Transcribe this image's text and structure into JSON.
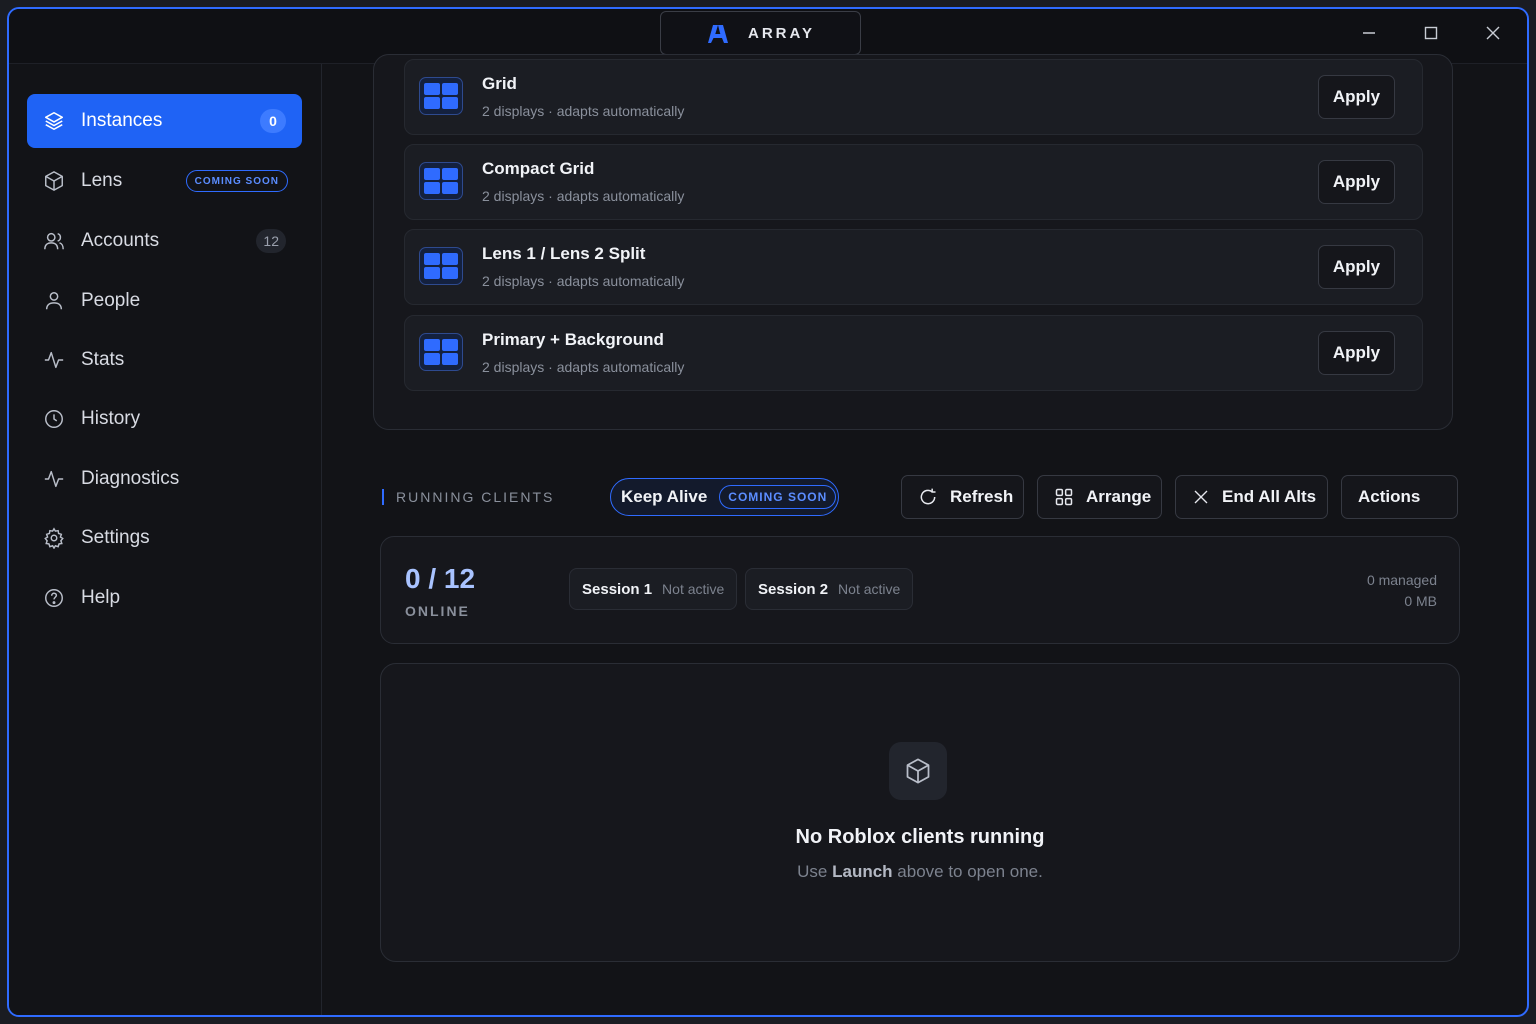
{
  "app": {
    "title": "ARRAY"
  },
  "sidebar": {
    "items": [
      {
        "label": "Instances",
        "badge": "0",
        "icon": "layers-icon",
        "active": true
      },
      {
        "label": "Lens",
        "soon": "COMING SOON",
        "icon": "cube-icon"
      },
      {
        "label": "Accounts",
        "badge": "12",
        "icon": "users-icon"
      },
      {
        "label": "People",
        "icon": "person-icon"
      },
      {
        "label": "Stats",
        "icon": "activity-icon"
      },
      {
        "label": "History",
        "icon": "clock-icon"
      },
      {
        "label": "Diagnostics",
        "icon": "pulse-icon"
      },
      {
        "label": "Settings",
        "icon": "gear-icon"
      },
      {
        "label": "Help",
        "icon": "help-icon"
      }
    ]
  },
  "layouts": [
    {
      "title": "Grid",
      "subtitle": "2 displays · adapts automatically",
      "apply": "Apply"
    },
    {
      "title": "Compact Grid",
      "subtitle": "2 displays · adapts automatically",
      "apply": "Apply"
    },
    {
      "title": "Lens 1 / Lens 2 Split",
      "subtitle": "2 displays · adapts automatically",
      "apply": "Apply"
    },
    {
      "title": "Primary + Background",
      "subtitle": "2 displays · adapts automatically",
      "apply": "Apply"
    }
  ],
  "running": {
    "section_label": "RUNNING CLIENTS",
    "keep_alive": {
      "label": "Keep Alive",
      "soon": "COMING SOON"
    },
    "toolbar": {
      "refresh": "Refresh",
      "arrange": "Arrange",
      "end_all": "End All Alts",
      "actions": "Actions"
    },
    "online_count": "0 / 12",
    "online_label": "ONLINE",
    "sessions": [
      {
        "name": "Session 1",
        "status": "Not active"
      },
      {
        "name": "Session 2",
        "status": "Not active"
      }
    ],
    "managed": "0 managed",
    "memory": "0 MB"
  },
  "empty": {
    "title": "No Roblox clients running",
    "sub_prefix": "Use ",
    "sub_bold": "Launch",
    "sub_suffix": " above to open one."
  },
  "colors": {
    "accent": "#1f63f5",
    "accent_border": "#2f6bff",
    "background": "#121317"
  }
}
